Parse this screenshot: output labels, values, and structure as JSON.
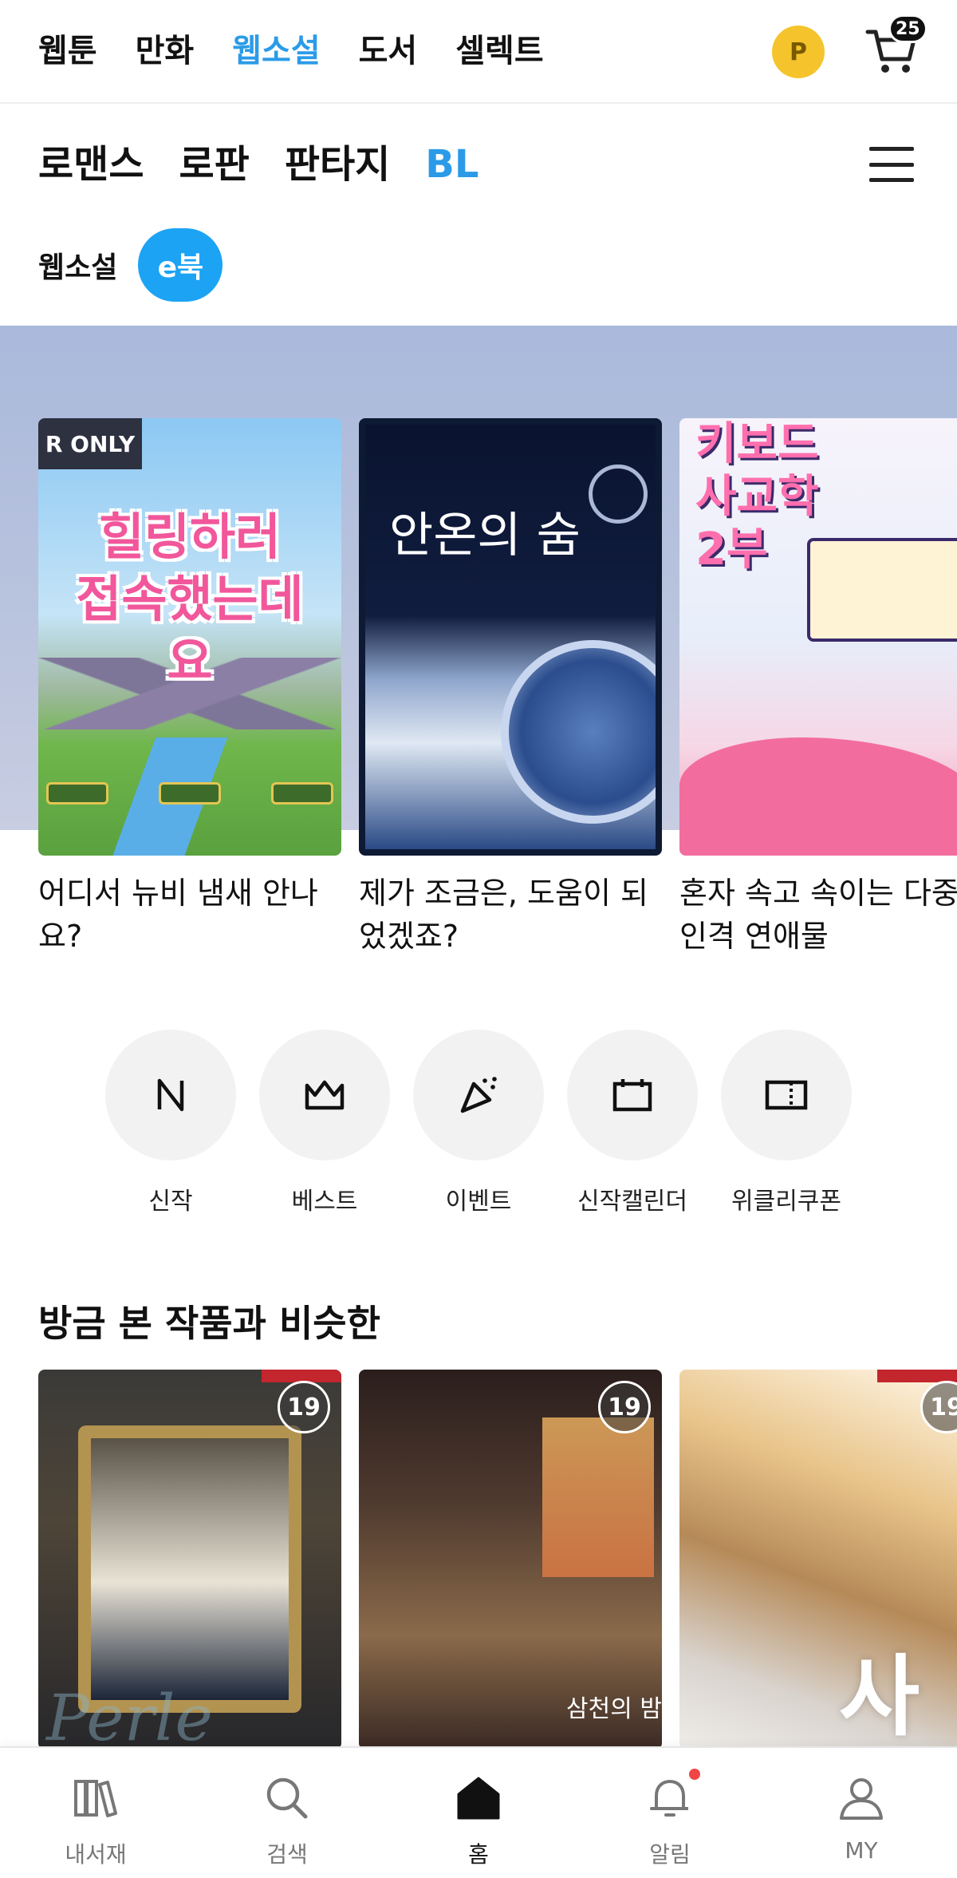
{
  "top_nav": {
    "tabs": [
      {
        "label": "웹툰"
      },
      {
        "label": "만화"
      },
      {
        "label": "웹소설"
      },
      {
        "label": "도서"
      },
      {
        "label": "셀렉트"
      }
    ],
    "active_tab": "웹소설",
    "point_badge": "P",
    "cart_count": "25"
  },
  "genre_nav": {
    "tabs": [
      {
        "label": "로맨스"
      },
      {
        "label": "로판"
      },
      {
        "label": "판타지"
      },
      {
        "label": "BL"
      }
    ],
    "active_tab": "BL"
  },
  "format_filter": {
    "options": [
      "웹소설",
      "e북"
    ],
    "selected": "e북"
  },
  "hero": {
    "items": [
      {
        "title": "어디서 뉴비 냄새 안나요?",
        "cover_badge": "R ONLY",
        "cover_text": "힐링하러 접속했는데요"
      },
      {
        "title": "제가 조금은, 도움이 되었겠죠?",
        "cover_text": "안온의 숨"
      },
      {
        "title": "혼자 속고 속이는 다중인격 연애물",
        "cover_text": "키보드 사교학 2부"
      }
    ]
  },
  "shortcuts": [
    {
      "label": "신작",
      "icon": "new-n-icon"
    },
    {
      "label": "베스트",
      "icon": "crown-icon"
    },
    {
      "label": "이벤트",
      "icon": "party-popper-icon"
    },
    {
      "label": "신작캘린더",
      "icon": "calendar-icon"
    },
    {
      "label": "위클리쿠폰",
      "icon": "coupon-icon"
    }
  ],
  "recommend": {
    "title": "방금 본 작품과 비슷한",
    "items": [
      {
        "age": "19",
        "cover_text": "Perle"
      },
      {
        "age": "19",
        "cover_text": "삼천의 밤"
      },
      {
        "age": "19",
        "cover_text": "사"
      }
    ]
  },
  "bottom_nav": {
    "items": [
      {
        "label": "내서재",
        "icon": "library-icon"
      },
      {
        "label": "검색",
        "icon": "search-icon"
      },
      {
        "label": "홈",
        "icon": "home-icon"
      },
      {
        "label": "알림",
        "icon": "bell-icon"
      },
      {
        "label": "MY",
        "icon": "user-icon"
      }
    ],
    "active": "홈"
  },
  "colors": {
    "accent": "#2b9be8",
    "chip_active": "#1ca3f4",
    "point_badge": "#f5c42c",
    "notification_dot": "#f04545"
  }
}
